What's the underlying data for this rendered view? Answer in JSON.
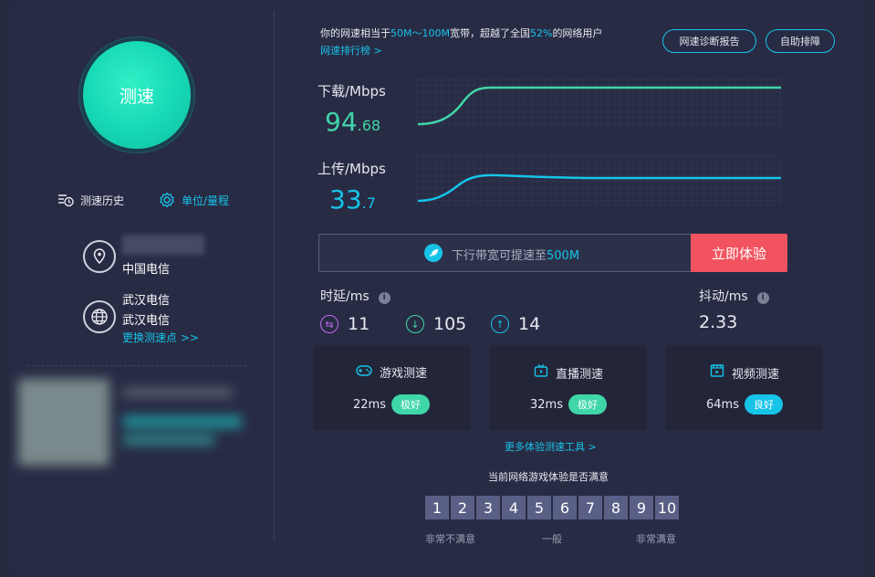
{
  "colors": {
    "accent": "#16c4e8",
    "download": "#3fd6a8",
    "cta": "#f2535f",
    "badge_excellent": "#3fd6a8",
    "badge_good": "#16c4e8"
  },
  "left": {
    "speed_button": "测速",
    "history_label": "测速历史",
    "unit_label": "单位/量程",
    "isp": "中国电信",
    "server_line1": "武汉电信",
    "server_line2": "武汉电信",
    "change_server": "更换测速点 >>"
  },
  "summary": {
    "prefix": "你的网速相当于",
    "bandwidth": "50M～100M",
    "mid": "宽带，超越了全国",
    "percent": "52%",
    "suffix": "的网络用户",
    "rank_link": "网速排行榜 >"
  },
  "buttons": {
    "diagnose": "网速诊断报告",
    "self_help": "自助排障"
  },
  "download": {
    "label": "下载/Mbps",
    "int": "94",
    "dec": ".68"
  },
  "upload": {
    "label": "上传/Mbps",
    "int": "33",
    "dec": ".7"
  },
  "promo": {
    "text_prefix": "下行带宽可提速至",
    "text_value": "500M",
    "button": "立即体验"
  },
  "latency": {
    "label": "时延/ms",
    "items": [
      {
        "icon": "swap-icon",
        "value": "11"
      },
      {
        "icon": "arrow-down-icon",
        "value": "105"
      },
      {
        "icon": "arrow-up-icon",
        "value": "14"
      }
    ]
  },
  "jitter": {
    "label": "抖动/ms",
    "value": "2.33"
  },
  "cards": [
    {
      "title": "游戏测速",
      "icon": "gamepad-icon",
      "value": "22ms",
      "badge": "极好"
    },
    {
      "title": "直播测速",
      "icon": "tv-icon",
      "value": "32ms",
      "badge": "极好"
    },
    {
      "title": "视频测速",
      "icon": "video-icon",
      "value": "64ms",
      "badge": "良好"
    }
  ],
  "more_tools": "更多体验测速工具 >",
  "survey": {
    "title": "当前网络游戏体验是否满意",
    "scores": [
      "1",
      "2",
      "3",
      "4",
      "5",
      "6",
      "7",
      "8",
      "9",
      "10"
    ],
    "low": "非常不满意",
    "mid": "一般",
    "high": "非常满意"
  }
}
